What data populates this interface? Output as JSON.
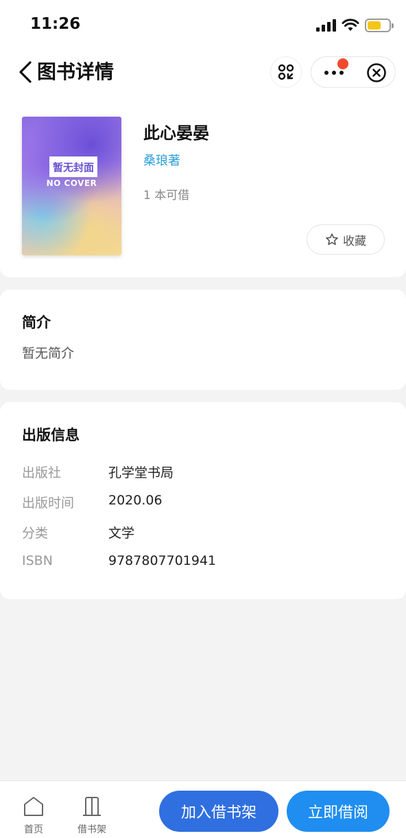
{
  "status": {
    "time": "11:26"
  },
  "nav": {
    "title": "图书详情"
  },
  "book": {
    "cover_label": "暂无封面",
    "cover_sub": "NO COVER",
    "title": "此心晏晏",
    "author": "桑琅著",
    "availability": "1 本可借",
    "favorite_label": "收藏"
  },
  "intro": {
    "title": "简介",
    "text": "暂无简介"
  },
  "publication": {
    "title": "出版信息",
    "rows": [
      {
        "key": "出版社",
        "value": "孔学堂书局"
      },
      {
        "key": "出版时间",
        "value": "2020.06"
      },
      {
        "key": "分类",
        "value": "文学"
      },
      {
        "key": "ISBN",
        "value": "9787807701941"
      }
    ]
  },
  "tabbar": {
    "home_label": "首页",
    "shelf_label": "借书架",
    "add_label": "加入借书架",
    "borrow_label": "立即借阅"
  },
  "colors": {
    "accent_blue": "#2f6fe0",
    "borrow_blue": "#1f8ef0",
    "author_blue": "#2c9fd6",
    "notify_red": "#f04a2e",
    "battery_yellow": "#f5c518"
  }
}
